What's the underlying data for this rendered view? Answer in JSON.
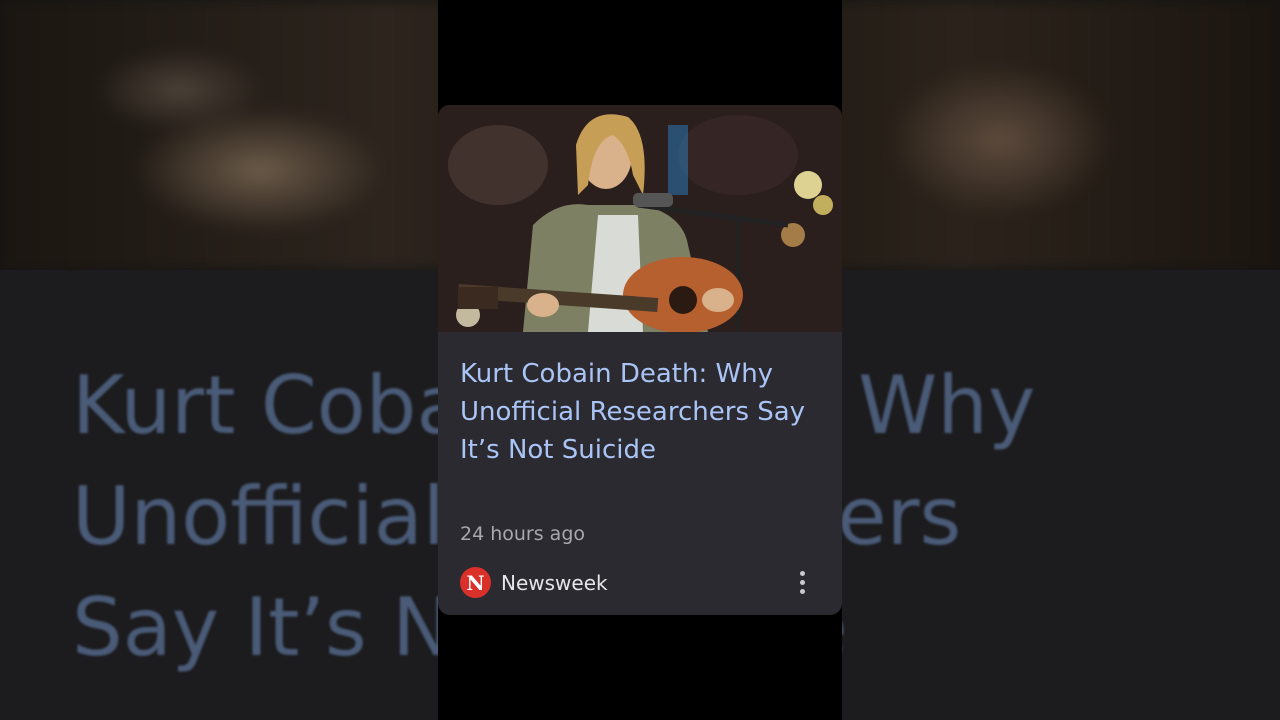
{
  "article": {
    "title": "Kurt Cobain Death: Why Unofficial Researchers Say It’s Not Suicide",
    "time": "24 hours ago",
    "source": "Newsweek",
    "source_logo_letter": "N",
    "image_description": "photo of Kurt Cobain playing acoustic guitar at microphone"
  },
  "background": {
    "title": "Kurt Cobain Death: Why Unofficial Researchers Say It’s Not Suicide"
  },
  "menu": {
    "icon": "more-vert-icon"
  },
  "colors": {
    "title_link": "#a9c4f5",
    "card_background": "#2b2a30",
    "source_logo": "#d9302a"
  }
}
